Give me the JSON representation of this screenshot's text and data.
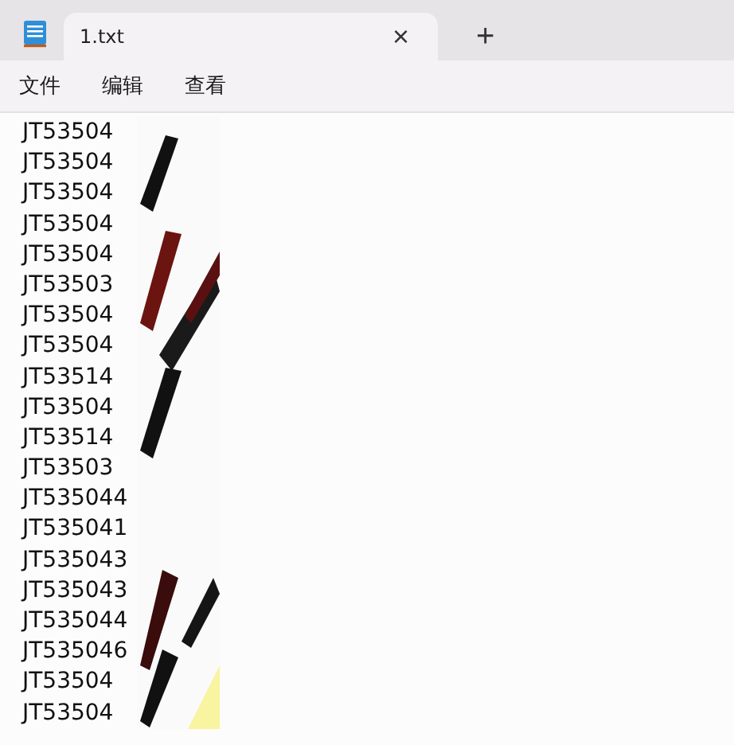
{
  "tabs": [
    {
      "label": "1.txt",
      "selected": true
    }
  ],
  "tab_close": "×",
  "new_tab": "+",
  "menu": [
    "文件",
    "编辑",
    "查看"
  ],
  "lines": [
    "JT53504",
    "JT53504",
    "JT53504",
    "JT53504",
    "JT53504",
    "JT53503",
    "JT53504",
    "JT53504",
    "JT53514",
    "JT53504",
    "JT53514",
    "JT53503",
    "JT535044",
    "JT535041",
    "JT535043",
    "JT535043",
    "JT535044",
    "JT535046",
    "JT53504",
    "JT53504"
  ]
}
